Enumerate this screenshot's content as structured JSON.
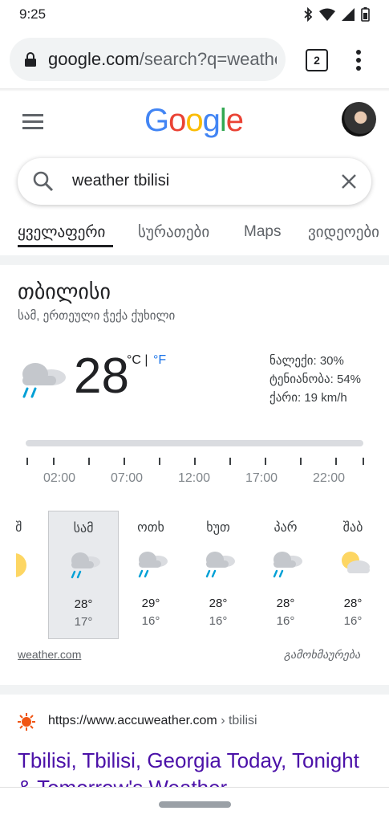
{
  "status": {
    "time": "9:25"
  },
  "browser": {
    "url_host": "google.com",
    "url_rest": "/search?q=weathe",
    "tab_count": "2"
  },
  "google": {
    "logo": [
      "G",
      "o",
      "o",
      "g",
      "l",
      "e"
    ],
    "logo_colors": [
      "#4285F4",
      "#EA4335",
      "#FBBC05",
      "#4285F4",
      "#34A853",
      "#EA4335"
    ]
  },
  "search": {
    "query": "weather tbilisi"
  },
  "tabs": [
    {
      "label": "ყველაფერი"
    },
    {
      "label": "სურათები"
    },
    {
      "label": "Maps"
    },
    {
      "label": "ვიდეოები"
    }
  ],
  "weather": {
    "city": "თბილისი",
    "day_condition": "სამ, ერთეული ჭექა ქუხილი",
    "temp": "28",
    "unit_c": "°C",
    "unit_sep": "|",
    "unit_f": "°F",
    "precip": "ნალექი: 30%",
    "humidity": "ტენიანობა: 54%",
    "wind": "ქარი: 19 km/h",
    "times": [
      "02:00",
      "07:00",
      "12:00",
      "17:00",
      "22:00"
    ],
    "days": [
      {
        "name": "ოშ",
        "icon": "sun-icon",
        "hi": "°",
        "lo": "°"
      },
      {
        "name": "სამ",
        "icon": "rain-cloud-icon",
        "hi": "28°",
        "lo": "17°"
      },
      {
        "name": "ოთხ",
        "icon": "rain-cloud-icon",
        "hi": "29°",
        "lo": "16°"
      },
      {
        "name": "ხუთ",
        "icon": "rain-cloud-icon",
        "hi": "28°",
        "lo": "16°"
      },
      {
        "name": "პარ",
        "icon": "rain-cloud-icon",
        "hi": "28°",
        "lo": "16°"
      },
      {
        "name": "შაბ",
        "icon": "partly-cloudy-icon",
        "hi": "28°",
        "lo": "16°"
      }
    ],
    "source": "weather.com",
    "feedback": "გამოხმაურება"
  },
  "result": {
    "url": "https://www.accuweather.com",
    "crumb": " › tbilisi",
    "title": "Tbilisi, Tbilisi, Georgia Today, Tonight & Tomorrow's Weather"
  }
}
